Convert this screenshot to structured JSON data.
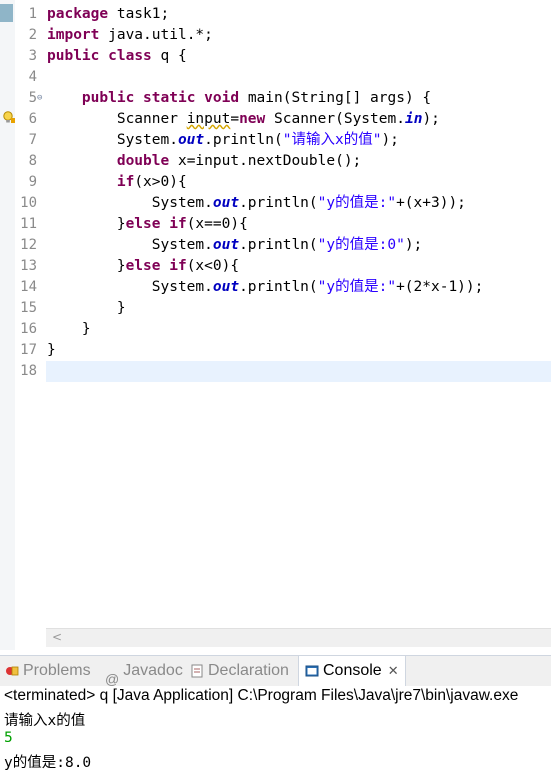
{
  "editor": {
    "line_numbers": [
      "1",
      "2",
      "3",
      "4",
      "5",
      "6",
      "7",
      "8",
      "9",
      "10",
      "11",
      "12",
      "13",
      "14",
      "15",
      "16",
      "17",
      "18"
    ],
    "code": {
      "l1": {
        "kw": "package",
        "rest": " task1;"
      },
      "l2": {
        "kw": "import",
        "rest": " java.util.*;"
      },
      "l3": {
        "kw1": "public",
        "kw2": "class",
        "rest": " q {"
      },
      "l5": {
        "kw1": "public",
        "kw2": "static",
        "kw3": "void",
        "rest": " main(String[] args) {"
      },
      "l6": {
        "a": "Scanner ",
        "var": "input",
        "b": "=",
        "kw": "new",
        "c": " Scanner(System.",
        "fld": "in",
        "d": ");"
      },
      "l7": {
        "a": "System.",
        "fld": "out",
        "b": ".println(",
        "str": "\"请输入x的值\"",
        "c": ");"
      },
      "l8": {
        "kw": "double",
        "rest": " x=input.nextDouble();"
      },
      "l9": {
        "kw": "if",
        "rest": "(x>0){"
      },
      "l10": {
        "a": "System.",
        "fld": "out",
        "b": ".println(",
        "str": "\"y的值是:\"",
        "c": "+(x+3));"
      },
      "l11": {
        "a": "}",
        "kw1": "else",
        "kw2": "if",
        "rest": "(x==0){"
      },
      "l12": {
        "a": "System.",
        "fld": "out",
        "b": ".println(",
        "str": "\"y的值是:0\"",
        "c": ");"
      },
      "l13": {
        "a": "}",
        "kw1": "else",
        "kw2": "if",
        "rest": "(x<0){"
      },
      "l14": {
        "a": "System.",
        "fld": "out",
        "b": ".println(",
        "str": "\"y的值是:\"",
        "c": "+(2*x-1));"
      },
      "l15": "}",
      "l16": "}",
      "l17": "}"
    }
  },
  "tabs": {
    "problems": "Problems",
    "javadoc": "Javadoc",
    "declaration": "Declaration",
    "console": "Console",
    "close": "✕"
  },
  "console": {
    "terminated": "<terminated> q [Java Application] C:\\Program Files\\Java\\jre7\\bin\\javaw.exe",
    "prompt": "请输入x的值",
    "input": "5",
    "result": "y的值是:8.0"
  },
  "colors": {
    "keyword": "#7f0055",
    "string": "#2a00ff",
    "field": "#0000c0",
    "console_input": "#00a000",
    "current_line": "#e8f2fe"
  }
}
